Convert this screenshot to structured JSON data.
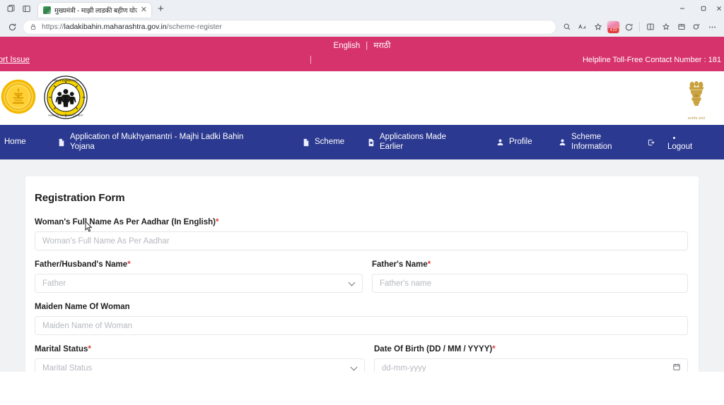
{
  "browser": {
    "tab": {
      "title": "मुख्यमंत्री - माझी लाडकी बहीण योजना",
      "close_label": "✕",
      "favicon_name": "site-favicon"
    },
    "new_tab_label": "+",
    "url": {
      "scheme": "https://",
      "host": "ladakibahin.maharashtra.gov.in",
      "path": "/scheme-register"
    },
    "extension_badge": "4:23",
    "window_controls": {
      "minimize": "—",
      "maximize": "▢",
      "close": "✕"
    },
    "toolbar_icons": [
      "search-icon",
      "read-aloud-icon",
      "favorite-star-icon",
      "extension-icon",
      "copilot-icon",
      "split-screen-icon",
      "collections-icon",
      "browser-essentials-icon",
      "settings-more-icon"
    ]
  },
  "topbar": {
    "language_english": "English",
    "language_separator": "|",
    "language_marathi": "मराठी",
    "report_issue": "eport Issue",
    "pipe": "|",
    "helpline": "Helpline Toll-Free Contact Number : 181"
  },
  "emblems": {
    "state_name": "maharashtra-state-emblem",
    "wcd_name": "women-and-child-development-logo",
    "india_name": "india-national-emblem",
    "india_motto": "सत्यमेव जयते"
  },
  "nav": {
    "items": [
      {
        "label": "Home",
        "icon": "home-icon",
        "name": "nav-home"
      },
      {
        "label": "Application of Mukhyamantri - Majhi Ladki Bahin Yojana",
        "icon": "file-icon",
        "name": "nav-application"
      },
      {
        "label": "Scheme",
        "icon": "file-icon",
        "name": "nav-scheme"
      },
      {
        "label": "Applications Made Earlier",
        "icon": "file-icon",
        "name": "nav-applications-made-earlier"
      },
      {
        "label": "Profile",
        "icon": "user-icon",
        "name": "nav-profile"
      },
      {
        "label": "Scheme Information",
        "icon": "user-icon",
        "name": "nav-scheme-information"
      },
      {
        "label": "Logout",
        "icon": "logout-icon",
        "name": "nav-logout"
      }
    ]
  },
  "form": {
    "title": "Registration Form",
    "fields": {
      "full_name": {
        "label": "Woman's Full Name As Per Aadhar (In English)",
        "required": "*",
        "placeholder": "Woman's Full Name As Per Aadhar",
        "value": ""
      },
      "father_husband": {
        "label": "Father/Husband's Name",
        "required": "*",
        "selected": "Father"
      },
      "fathers_name": {
        "label": "Father's Name",
        "required": "*",
        "placeholder": "Father's name",
        "value": ""
      },
      "maiden_name": {
        "label": "Maiden Name Of Woman",
        "required": "",
        "placeholder": "Maiden Name of Woman",
        "value": ""
      },
      "marital_status": {
        "label": "Marital Status",
        "required": "*",
        "selected": "Marital Status"
      },
      "date_of_birth": {
        "label": "Date Of Birth (DD / MM / YYYY)",
        "required": "*",
        "placeholder": "dd-mm-yyyy",
        "value": ""
      }
    }
  },
  "colors": {
    "pink": "#d6336c",
    "navy": "#2b3990",
    "required": "#e23b3b",
    "page_bg": "#f1f2f4"
  }
}
